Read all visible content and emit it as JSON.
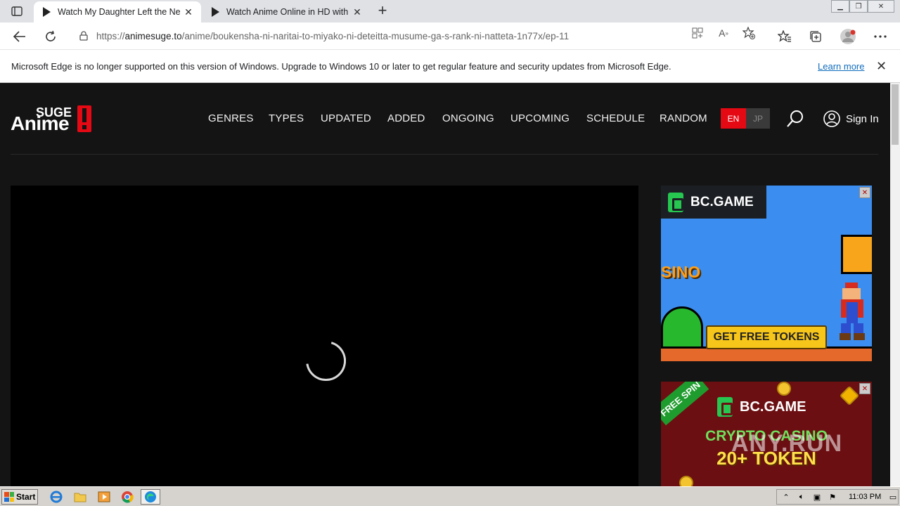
{
  "browser": {
    "tabs": [
      {
        "title": "Watch My Daughter Left the Nest",
        "active": true
      },
      {
        "title": "Watch Anime Online in HD with",
        "active": false
      }
    ],
    "url_scheme": "https://",
    "url_host": "animesuge.to",
    "url_path": "/anime/boukensha-ni-naritai-to-miyako-ni-deteitta-musume-ga-s-rank-ni-natteta-1n77x/ep-11",
    "infobar_message": "Microsoft Edge is no longer supported on this version of Windows. Upgrade to Windows 10 or later to get regular feature and security updates from Microsoft Edge.",
    "infobar_link": "Learn more"
  },
  "site": {
    "logo_top": "SUGE",
    "logo_main": "Anime",
    "nav": [
      "GENRES",
      "TYPES",
      "UPDATED",
      "ADDED",
      "ONGOING",
      "UPCOMING",
      "SCHEDULE",
      "RANDOM"
    ],
    "lang_en": "EN",
    "lang_jp": "JP",
    "sign_in": "Sign In"
  },
  "ads": {
    "ad1_brand": "BC.GAME",
    "ad1_casino": "SINO",
    "ad1_cta": "GET FREE TOKENS",
    "ad2_ribbon": "FREE SPIN",
    "ad2_brand": "BC.GAME",
    "ad2_line1": "CRYPTO CASINO",
    "ad2_line2": "20+ TOKEN"
  },
  "watermark": "ANY.RUN",
  "taskbar": {
    "start": "Start",
    "clock": "11:03 PM"
  },
  "colors": {
    "accent": "#e50914",
    "page_bg": "#141414"
  }
}
